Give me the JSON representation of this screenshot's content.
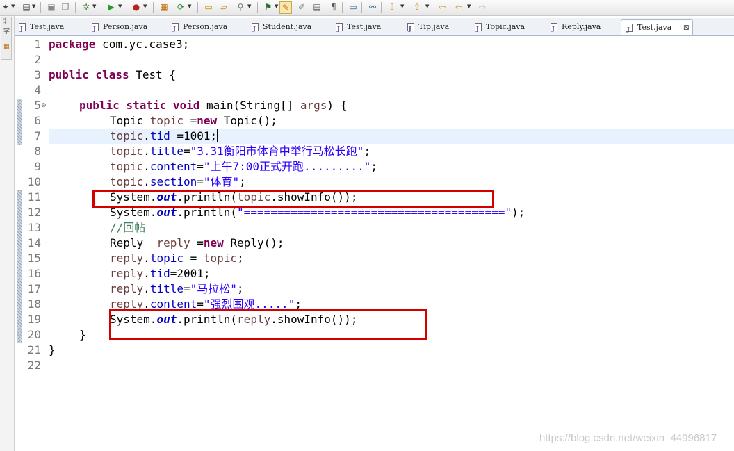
{
  "toolbar": {
    "icons": [
      "new-icon",
      "open-icon",
      "save-icon",
      "save-all-icon",
      "debug-icon",
      "run-icon",
      "stop-icon",
      "package-icon",
      "refresh-icon",
      "folder-icon",
      "open-folder-icon",
      "search-icon",
      "edit-icon",
      "document-icon",
      "format-icon",
      "console-icon",
      "link-icon",
      "arrow-down-icon",
      "arrow-up-icon",
      "back-icon",
      "forward-icon"
    ]
  },
  "tabs": [
    {
      "label": "Test.java"
    },
    {
      "label": "Person.java"
    },
    {
      "label": "Person.java"
    },
    {
      "label": "Student.java"
    },
    {
      "label": "Test.java"
    },
    {
      "label": "Tip.java"
    },
    {
      "label": "Topic.java"
    },
    {
      "label": "Reply.java"
    },
    {
      "label": "Test.java",
      "active": true
    }
  ],
  "close_glyph": "⊠",
  "code": {
    "line_numbers": [
      "1",
      "2",
      "3",
      "4",
      "5",
      "6",
      "7",
      "8",
      "9",
      "10",
      "11",
      "12",
      "13",
      "14",
      "15",
      "16",
      "17",
      "18",
      "19",
      "20",
      "21",
      "22"
    ],
    "l1_kw": "package",
    "l1_rest": " com.yc.case3;",
    "l3_kw": "public class",
    "l3_rest": " Test {",
    "l5_kw": "public static void",
    "l5_rest": " main(String[] ",
    "l5_var": "args",
    "l5_end": ") {",
    "l6_a": "Topic ",
    "l6_var": "topic",
    "l6_b": " =",
    "l6_kw": "new",
    "l6_c": " Topic();",
    "l7_var": "topic",
    "l7_dot": ".",
    "l7_fld": "tid",
    "l7_b": " =1001;",
    "l8_var": "topic",
    "l8_dot": ".",
    "l8_fld": "title",
    "l8_b": "=",
    "l8_str": "\"3.31衡阳市体育中举行马松长跑\"",
    "l8_c": ";",
    "l9_var": "topic",
    "l9_dot": ".",
    "l9_fld": "content",
    "l9_b": "=",
    "l9_str": "\"上午7:00正式开跑.........\"",
    "l9_c": ";",
    "l10_var": "topic",
    "l10_dot": ".",
    "l10_fld": "section",
    "l10_b": "=",
    "l10_str": "\"体育\"",
    "l10_c": ";",
    "l11_a": "System.",
    "l11_st": "out",
    "l11_b": ".println(",
    "l11_var": "topic",
    "l11_c": ".showInfo());",
    "l12_a": "System.",
    "l12_st": "out",
    "l12_b": ".println(",
    "l12_str": "\"=======================================\"",
    "l12_c": ");",
    "l13_cm": "//回帖",
    "l14_a": "Reply  ",
    "l14_var": "reply",
    "l14_b": " =",
    "l14_kw": "new",
    "l14_c": " Reply();",
    "l15_var": "reply",
    "l15_dot": ".",
    "l15_fld": "topic",
    "l15_b": " = ",
    "l15_var2": "topic",
    "l15_c": ";",
    "l16_var": "reply",
    "l16_dot": ".",
    "l16_fld": "tid",
    "l16_b": "=2001;",
    "l17_var": "reply",
    "l17_dot": ".",
    "l17_fld": "title",
    "l17_b": "=",
    "l17_str": "\"马拉松\"",
    "l17_c": ";",
    "l18_var": "reply",
    "l18_dot": ".",
    "l18_fld": "content",
    "l18_b": "=",
    "l18_str": "\"强烈围观.....\"",
    "l18_c": ";",
    "l19_a": "System.",
    "l19_st": "out",
    "l19_b": ".println(",
    "l19_var": "reply",
    "l19_c": ".showInfo());",
    "l20": "}",
    "l21": "}"
  },
  "watermark": "https://blog.csdn.net/weixin_44996817"
}
